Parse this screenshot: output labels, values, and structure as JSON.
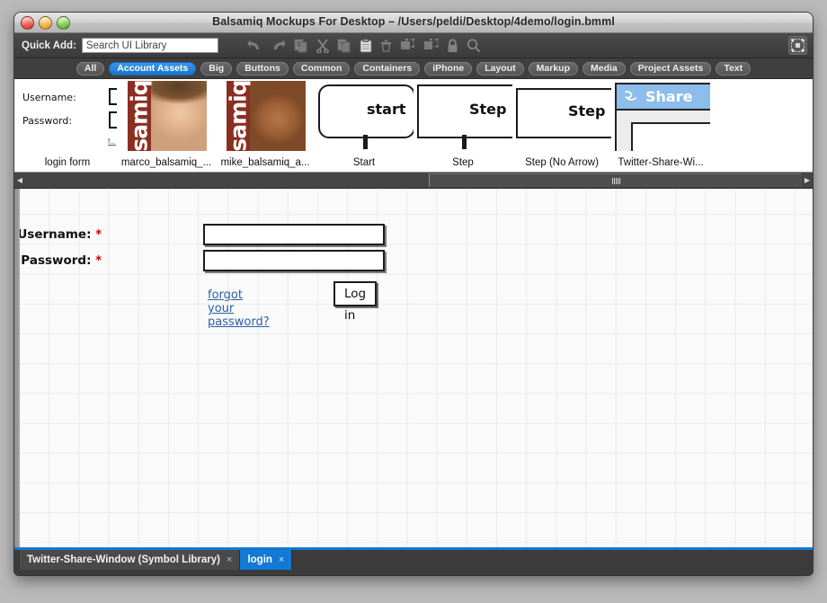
{
  "window": {
    "title": "Balsamiq Mockups For Desktop – /Users/peldi/Desktop/4demo/login.bmml",
    "traffic_lights": [
      "close-button",
      "minimize-button",
      "zoom-button"
    ]
  },
  "toolbar": {
    "quick_add_label": "Quick Add:",
    "search_placeholder": "Search UI Library",
    "search_value": "Search UI Library",
    "icons": [
      "undo-icon",
      "redo-icon",
      "copy-icon",
      "cut-icon",
      "duplicate-icon",
      "paste-icon",
      "trash-icon",
      "group-icon",
      "ungroup-icon",
      "lock-icon",
      "zoom-icon"
    ],
    "fit_icon": "fit-to-screen-icon"
  },
  "category_tabs": [
    {
      "label": "All",
      "selected": false
    },
    {
      "label": "Account Assets",
      "selected": true
    },
    {
      "label": "Big",
      "selected": false
    },
    {
      "label": "Buttons",
      "selected": false
    },
    {
      "label": "Common",
      "selected": false
    },
    {
      "label": "Containers",
      "selected": false
    },
    {
      "label": "iPhone",
      "selected": false
    },
    {
      "label": "Layout",
      "selected": false
    },
    {
      "label": "Markup",
      "selected": false
    },
    {
      "label": "Media",
      "selected": false
    },
    {
      "label": "Project Assets",
      "selected": false
    },
    {
      "label": "Text",
      "selected": false
    }
  ],
  "library": {
    "assets": [
      {
        "caption": "login form",
        "kind": "login-form"
      },
      {
        "caption": "marco_balsamiq_...",
        "kind": "photo",
        "word": "samiq"
      },
      {
        "caption": "mike_balsamiq_a...",
        "kind": "photo",
        "word": "samiq"
      },
      {
        "caption": "Start",
        "kind": "shape",
        "text": "start"
      },
      {
        "caption": "Step",
        "kind": "shape",
        "text": "Step"
      },
      {
        "caption": "Step (No Arrow)",
        "kind": "shape",
        "text": "Step"
      },
      {
        "caption": "Twitter-Share-Wi...",
        "kind": "window",
        "text": "Share"
      }
    ],
    "thumb_login": {
      "username_label": "Username:",
      "password_label": "Password:",
      "link": "f..."
    }
  },
  "hscroll": {
    "left_arrow": "◀",
    "right_arrow": "▶"
  },
  "canvas": {
    "form": {
      "username_label": "Username:",
      "password_label": "Password:",
      "required_marker": "*",
      "username_value": "",
      "password_value": "",
      "forgot_link": "forgot your password?",
      "submit_label": "Log in"
    }
  },
  "bottom_tabs": [
    {
      "label": "Twitter-Share-Window (Symbol Library)",
      "close": "×",
      "active": false
    },
    {
      "label": "login",
      "close": "×",
      "active": true
    }
  ],
  "colors": {
    "accent_blue": "#1279d4",
    "required_red": "#cc0000",
    "link_blue": "#2b5fa8",
    "canvas_bg": "#fafafa",
    "chrome_dark": "#3b3b3b"
  }
}
